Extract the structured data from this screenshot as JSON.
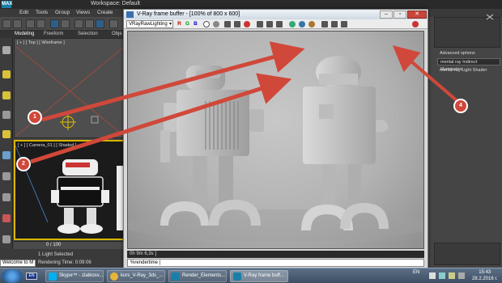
{
  "app": {
    "workspace_label": "Workspace: Default",
    "logo_text": "MAX",
    "menus": [
      "Edit",
      "Tools",
      "Group",
      "Views",
      "Create"
    ],
    "ribbon_tabs": [
      "Modeling",
      "Freeform",
      "Selection",
      "Obje"
    ],
    "viewport_top_label": "[ + ] [ Top ] [ Wireframe ]",
    "viewport_cam_label": "[ + ] [ Camera_01 ] [ Shaded ]",
    "timeline": "0 / 100",
    "status_selection": "1 Light Selected",
    "status_render_time": "Rendering Time: 0:09:06",
    "welcome": "Welcome to M"
  },
  "right_panel": {
    "items": [
      "Advanced options",
      "mental ray Indirect Illumination",
      "mental ray Light Shader"
    ]
  },
  "vfb": {
    "title": "V-Ray frame buffer - [100% of 800 x 600]",
    "channel": "VRayRawLighting",
    "rgb": [
      "R",
      "G",
      "B"
    ],
    "status": "0h  9m  6,3s ]",
    "command": "%rendertime |"
  },
  "taskbar": {
    "flag_text": "EN",
    "tasks": [
      "Skype™ - zlatkosv...",
      "kurs_V-Ray_3ds_...",
      "Render_Elements...",
      "V-Ray frame buff..."
    ],
    "lang": "EN",
    "time": "15:43",
    "date": "28.2.2016 г."
  },
  "annotations": [
    "1",
    "2",
    "4"
  ],
  "colors": {
    "arrow_red": "#d0483a",
    "cam_border": "#d9b500",
    "close_button": "#c8453a"
  }
}
